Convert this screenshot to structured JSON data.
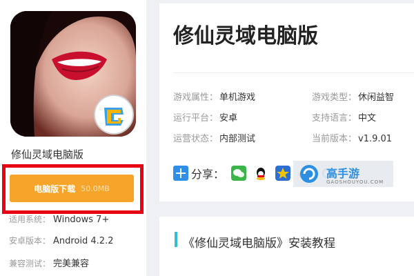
{
  "left": {
    "app_name": "修仙灵域电脑版",
    "download_label": "电脑版下载",
    "download_size": "50.0MB",
    "specs": [
      {
        "key": "适用系统：",
        "value": "Windows 7+"
      },
      {
        "key": "安卓版本：",
        "value": "Android 4.2.2"
      },
      {
        "key": "兼容测试：",
        "value": "完美兼容"
      }
    ]
  },
  "main": {
    "title": "修仙灵域电脑版",
    "attrs": [
      {
        "key": "游戏属性：",
        "value": "单机游戏"
      },
      {
        "key": "游戏类型：",
        "value": "休闲益智"
      },
      {
        "key": "运行平台：",
        "value": "安卓"
      },
      {
        "key": "支持语言：",
        "value": "中文"
      },
      {
        "key": "运营状态：",
        "value": "内部测试"
      },
      {
        "key": "当前版本：",
        "value": "v1.9.01"
      }
    ],
    "share_label": "分享：",
    "share_icons": [
      "wechat-icon",
      "qq-icon",
      "qzone-icon",
      "weibo-icon",
      "tencent-weibo-icon"
    ],
    "brand_name": "高手游",
    "brand_sub": "GAOSHOUYOU.COM"
  },
  "tutorial": {
    "title": "《修仙灵域电脑版》安装教程"
  },
  "colors": {
    "download_button": "#f6a52a",
    "highlight_frame": "#e60012",
    "accent_bar": "#2ec0d8",
    "brand": "#2d8fe2"
  }
}
